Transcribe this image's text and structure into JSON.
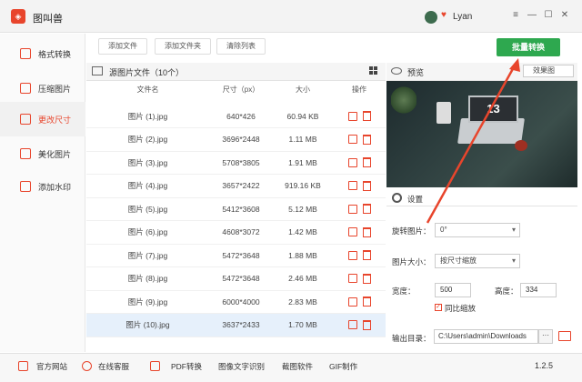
{
  "app": {
    "title": "图叫兽",
    "user_name": "Lyan",
    "version": "1.2.5"
  },
  "sidebar": {
    "items": [
      {
        "label": "格式转换"
      },
      {
        "label": "压缩图片"
      },
      {
        "label": "更改尺寸"
      },
      {
        "label": "美化图片"
      },
      {
        "label": "添加水印"
      }
    ],
    "active": "更改尺寸"
  },
  "toolbar": {
    "add_file": "添加文件",
    "add_folder": "添加文件夹",
    "clear_list": "清除列表",
    "batch_convert": "批量转换"
  },
  "file_list": {
    "title": "源图片文件（10个）",
    "columns": [
      "文件名",
      "尺寸（px）",
      "大小",
      "操作"
    ],
    "rows": [
      {
        "name": "图片 (1).jpg",
        "dims": "640*426",
        "size": "60.94 KB"
      },
      {
        "name": "图片 (2).jpg",
        "dims": "3696*2448",
        "size": "1.11 MB"
      },
      {
        "name": "图片 (3).jpg",
        "dims": "5708*3805",
        "size": "1.91 MB"
      },
      {
        "name": "图片 (4).jpg",
        "dims": "3657*2422",
        "size": "919.16 KB"
      },
      {
        "name": "图片 (5).jpg",
        "dims": "5412*3608",
        "size": "5.12 MB"
      },
      {
        "name": "图片 (6).jpg",
        "dims": "4608*3072",
        "size": "1.42 MB"
      },
      {
        "name": "图片 (7).jpg",
        "dims": "5472*3648",
        "size": "1.88 MB"
      },
      {
        "name": "图片 (8).jpg",
        "dims": "5472*3648",
        "size": "2.46 MB"
      },
      {
        "name": "图片 (9).jpg",
        "dims": "6000*4000",
        "size": "2.83 MB"
      },
      {
        "name": "图片 (10).jpg",
        "dims": "3637*2433",
        "size": "1.70 MB"
      }
    ],
    "selected_index": 9
  },
  "preview": {
    "label": "预览",
    "effect_option": "效果图",
    "screen_text": "13"
  },
  "settings": {
    "label": "设置",
    "rotate_label": "旋转图片：",
    "rotate_value": "0°",
    "size_label": "图片大小：",
    "size_value": "按尺寸缩放",
    "width_label": "宽度：",
    "width_value": "500",
    "height_label": "高度：",
    "height_value": "334",
    "keep_ratio_label": "同比缩放",
    "output_label": "输出目录：",
    "output_path": "C:\\Users\\admin\\Downloads",
    "dots": "···"
  },
  "footer": {
    "items": [
      "官方网站",
      "在线客服",
      "PDF转换",
      "图像文字识别",
      "截图软件",
      "GIF制作"
    ]
  },
  "colors": {
    "accent": "#e8452c",
    "primary_button": "#2ea84f",
    "selected_row": "#e6f0fb"
  }
}
